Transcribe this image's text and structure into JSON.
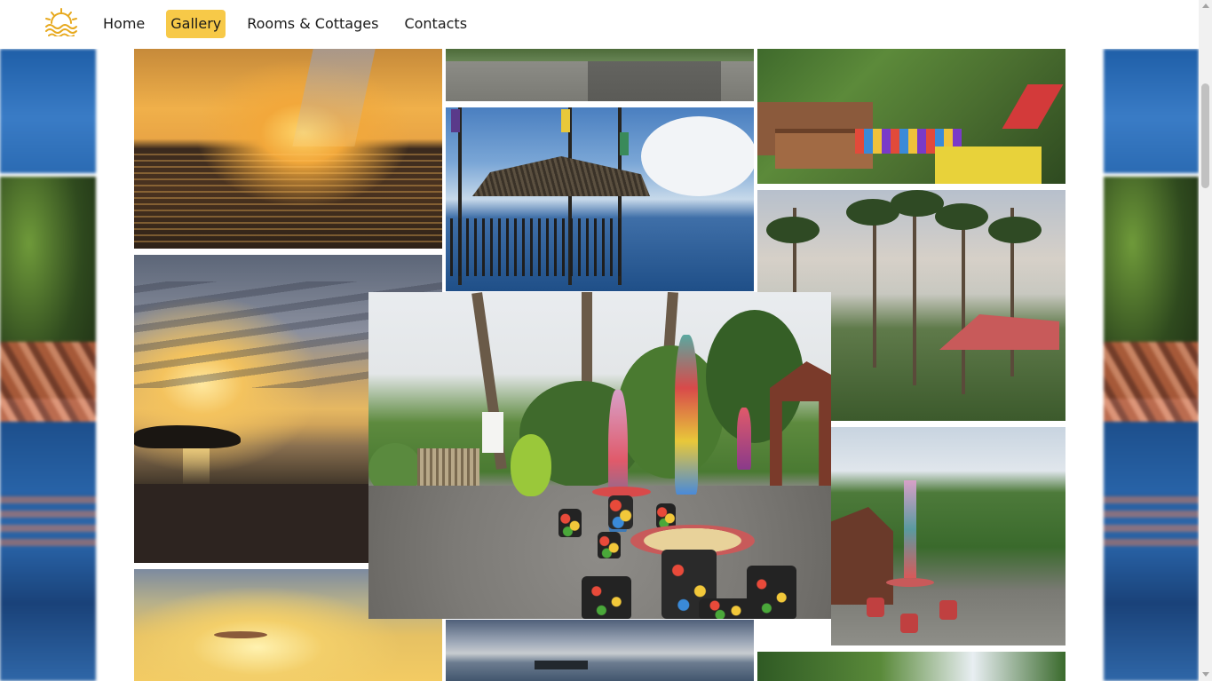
{
  "header": {
    "logo_icon": "sun-waves-logo-icon",
    "nav": [
      {
        "label": "Home",
        "active": false
      },
      {
        "label": "Gallery",
        "active": true
      },
      {
        "label": "Rooms & Cottages",
        "active": false
      },
      {
        "label": "Contacts",
        "active": false
      }
    ]
  },
  "colors": {
    "accent": "#f7c948",
    "header_bg": "#ffffff",
    "text": "#1a1a1a"
  },
  "gallery": {
    "photos": [
      {
        "name": "sunset-over-sea-photo"
      },
      {
        "name": "sunset-with-rock-photo"
      },
      {
        "name": "golden-sky-photo"
      },
      {
        "name": "resort-road-photo"
      },
      {
        "name": "nipa-hut-on-water-photo"
      },
      {
        "name": "boat-at-dusk-photo"
      },
      {
        "name": "colorful-garden-photo"
      },
      {
        "name": "palm-trees-cottages-photo"
      },
      {
        "name": "garden-cottage-photo"
      },
      {
        "name": "foliage-photo"
      }
    ],
    "featured": {
      "name": "featured-enlarged-photo"
    }
  }
}
